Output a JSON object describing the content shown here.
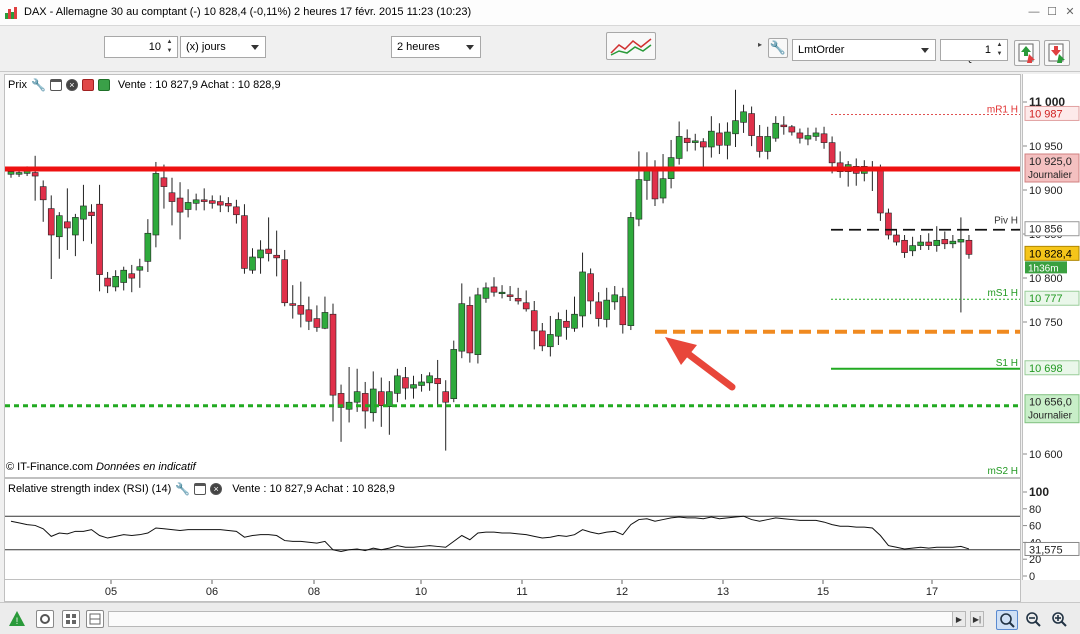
{
  "window": {
    "title": "DAX - Allemagne 30 au comptant (-)   10 828,4 (-0,11%)     2 heures   17 févr. 2015 11:23 (10:23)"
  },
  "toolbar": {
    "period_count": "10",
    "period_unit": "(x) jours",
    "interval": "2 heures",
    "order_type": "LmtOrder",
    "qty_label": "Qté",
    "qty_value": "1"
  },
  "price_panel": {
    "label": "Prix",
    "quote": "Vente : 10 827,9 Achat : 10 828,9",
    "source_note": "© IT-Finance.com",
    "source_note_italic": "Données en indicatif"
  },
  "rsi_panel": {
    "label": "Relative strength index (RSI) (14)",
    "quote": "Vente : 10 827,9 Achat : 10 828,9",
    "value_label": "31,575",
    "ticks": [
      "100",
      "80",
      "60",
      "40",
      "20",
      "0"
    ]
  },
  "levels": {
    "mR1": {
      "label": "mR1 H",
      "value": "10 987"
    },
    "journalier_high": {
      "value": "10 925,0",
      "label": "Journalier"
    },
    "piv": {
      "label": "Piv H",
      "value": "10 856"
    },
    "current": {
      "value": "10 828,4",
      "timer": "1h36m"
    },
    "mS1": {
      "label": "mS1 H",
      "value": "10 777"
    },
    "S1": {
      "label": "S1 H",
      "value": "10 698"
    },
    "journalier_low": {
      "value": "10 656,0",
      "label": "Journalier"
    },
    "mS2": {
      "label": "mS2 H"
    }
  },
  "price_ticks": [
    "11 000",
    "10 950",
    "10 900",
    "10 850",
    "10 800",
    "10 750",
    "10 600"
  ],
  "time_ticks": [
    "05",
    "06",
    "08",
    "10",
    "11",
    "12",
    "13",
    "15",
    "17"
  ],
  "colors": {
    "up": "#2eaa3c",
    "down": "#e0304a",
    "resistance": "#ee1111",
    "support": "#22aa22",
    "orange": "#f08a20",
    "arrow": "#e8463a"
  }
}
